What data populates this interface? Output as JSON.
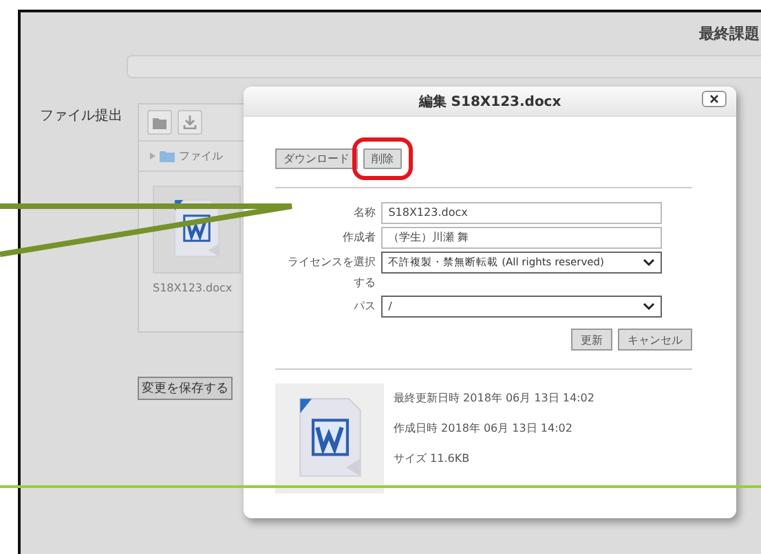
{
  "page": {
    "title": "最終課題",
    "section_label": "ファイル提出",
    "save_button": "変更を保存する"
  },
  "file_manager": {
    "folder": "ファイル",
    "file_name": "S18X123.docx"
  },
  "dialog": {
    "title": "編集 S18X123.docx",
    "actions": [
      {
        "label": "ダウンロード",
        "highlighted": false
      },
      {
        "label": "削除",
        "highlighted": true
      }
    ],
    "fields": [
      {
        "label": "名称",
        "kind": "text",
        "value": "S18X123.docx"
      },
      {
        "label": "作成者",
        "kind": "text",
        "value": "（学生）川瀬 舞"
      },
      {
        "label": "ライセンスを選択する",
        "kind": "select",
        "value": "不許複製・禁無断転載 (All rights reserved)"
      },
      {
        "label": "パス",
        "kind": "select",
        "value": "/"
      }
    ],
    "buttons": [
      "更新",
      "キャンセル"
    ],
    "info": [
      "最終更新日時 2018年 06月 13日 14:02",
      "作成日時 2018年 06月 13日 14:02",
      "サイズ 11.6KB"
    ]
  }
}
